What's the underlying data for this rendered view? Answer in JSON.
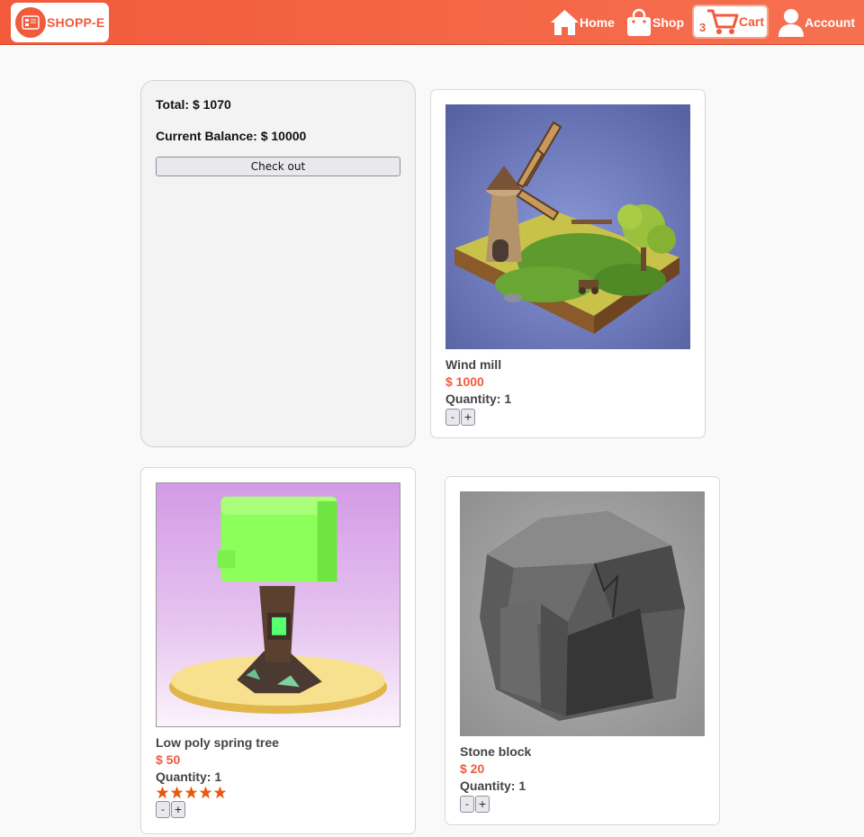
{
  "brand": {
    "name": "SHOPP-E",
    "logo_icon": "shop-logo-icon"
  },
  "nav": {
    "home": "Home",
    "shop": "Shop",
    "cart": "Cart",
    "cart_count": "3",
    "account": "Account"
  },
  "summary": {
    "total": "Total: $ 1070",
    "balance": "Current Balance: $ 10000",
    "checkout_label": "Check out"
  },
  "products": [
    {
      "name": "Wind mill",
      "price": "$ 1000",
      "quantity": "Quantity: 1",
      "image": "windmill-diorama",
      "rating": null
    },
    {
      "name": "Low poly spring tree",
      "price": "$ 50",
      "quantity": "Quantity: 1",
      "image": "low-poly-tree",
      "rating": 5
    },
    {
      "name": "Stone block",
      "price": "$ 20",
      "quantity": "Quantity: 1",
      "image": "stone-block",
      "rating": null
    }
  ],
  "qty_controls": {
    "minus": "-",
    "plus": "+"
  },
  "colors": {
    "accent": "#f15a3b",
    "star": "#e8590c",
    "page_bg": "#f9f9f9"
  }
}
